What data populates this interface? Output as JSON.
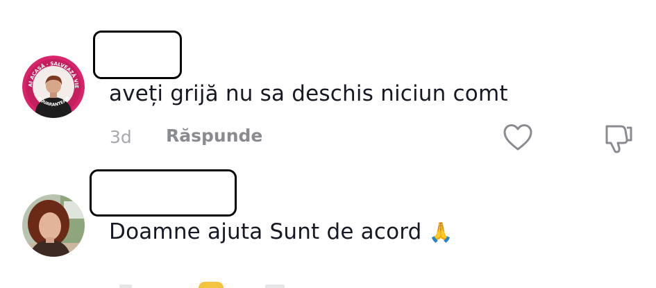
{
  "comments": [
    {
      "author": "",
      "text": "aveți grijă nu sa deschis niciun comt",
      "time": "3d",
      "reply_label": "Răspunde",
      "avatar": {
        "badge_text_top": "STAI ACASĂ · SALVEAZĂ VIEȚI",
        "badge_text_bottom": "#QUARANTEAM",
        "ring_color": "#e0276f"
      },
      "like_icon": "heart-outline-icon",
      "dislike_icon": "thumbs-down-outline-icon"
    },
    {
      "author": "",
      "text": "Doamne ajuta Sunt de acord",
      "emoji": "🙏"
    }
  ]
}
